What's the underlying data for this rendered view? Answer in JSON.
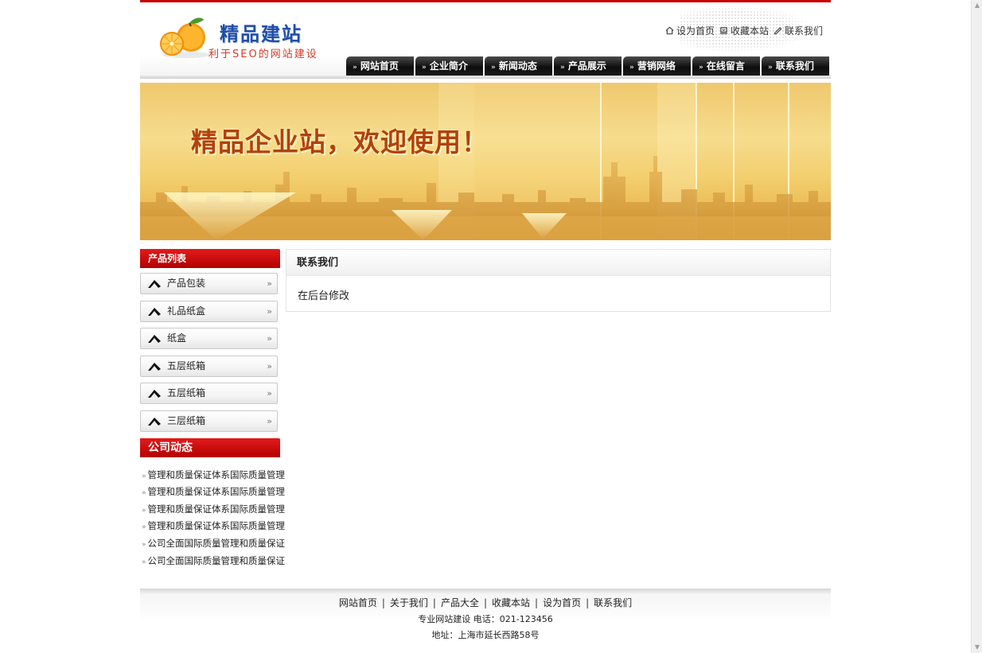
{
  "header": {
    "logo_title": "精品建站",
    "logo_subtitle": "利于SEO的网站建设",
    "top_links": [
      {
        "label": "设为首页",
        "icon": "home-icon"
      },
      {
        "label": "收藏本站",
        "icon": "bookmark-icon"
      },
      {
        "label": "联系我们",
        "icon": "contact-icon"
      }
    ],
    "nav": [
      "网站首页",
      "企业简介",
      "新闻动态",
      "产品展示",
      "营销网络",
      "在线留言",
      "联系我们"
    ],
    "nav_chevron": "»"
  },
  "banner": {
    "text": "精品企业站，欢迎使用！"
  },
  "sidebar": {
    "products_title": "产品列表",
    "products": [
      "产品包装",
      "礼品纸盒",
      "纸盒",
      "五层纸箱",
      "五层纸箱",
      "三层纸箱"
    ],
    "item_arrow": "»",
    "news_title": "公司动态",
    "news_bullet": "»",
    "news": [
      "管理和质量保证体系国际质量管理",
      "管理和质量保证体系国际质量管理",
      "管理和质量保证体系国际质量管理",
      "管理和质量保证体系国际质量管理",
      "公司全面国际质量管理和质量保证",
      "公司全面国际质量管理和质量保证"
    ]
  },
  "main": {
    "title": "联系我们",
    "body": "在后台修改"
  },
  "footer": {
    "links": [
      "网站首页",
      "关于我们",
      "产品大全",
      "收藏本站",
      "设为首页",
      "联系我们"
    ],
    "separator": "|",
    "contact_line": "专业网站建设 电话：021-123456",
    "address_line": "地址：上海市延长西路58号"
  },
  "colors": {
    "accent_red": "#c40000",
    "nav_black": "#111111",
    "logo_blue": "#1f4ea8",
    "banner_text": "#b2410c"
  }
}
